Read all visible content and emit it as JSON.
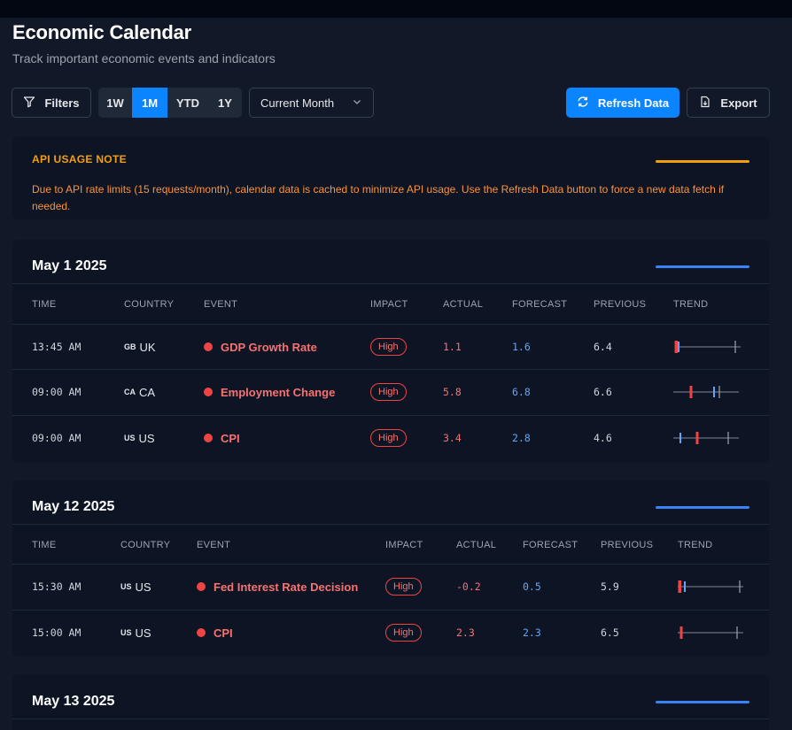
{
  "header": {
    "title": "Economic Calendar",
    "subtitle": "Track important economic events and indicators"
  },
  "toolbar": {
    "filters_label": "Filters",
    "ranges": [
      {
        "label": "1W",
        "active": false
      },
      {
        "label": "1M",
        "active": true
      },
      {
        "label": "YTD",
        "active": false
      },
      {
        "label": "1Y",
        "active": false
      }
    ],
    "period_select": "Current Month",
    "refresh_label": "Refresh Data",
    "export_label": "Export"
  },
  "note": {
    "title": "API USAGE NOTE",
    "text": "Due to API rate limits (15 requests/month), calendar data is cached to minimize API usage. Use the Refresh Data button to force a new data fetch if needed."
  },
  "columns": {
    "time": "TIME",
    "country": "COUNTRY",
    "event": "EVENT",
    "impact": "IMPACT",
    "actual": "ACTUAL",
    "forecast": "FORECAST",
    "previous": "PREVIOUS",
    "trend": "TREND"
  },
  "days": [
    {
      "date": "May 1 2025",
      "events": [
        {
          "time": "13:45 AM",
          "flag": "GB",
          "country": "UK",
          "event": "GDP Growth Rate",
          "impact": "High",
          "actual": "1.1",
          "forecast": "1.6",
          "previous": "6.4"
        },
        {
          "time": "09:00 AM",
          "flag": "CA",
          "country": "CA",
          "event": "Employment Change",
          "impact": "High",
          "actual": "5.8",
          "forecast": "6.8",
          "previous": "6.6"
        },
        {
          "time": "09:00 AM",
          "flag": "US",
          "country": "US",
          "event": "CPI",
          "impact": "High",
          "actual": "3.4",
          "forecast": "2.8",
          "previous": "4.6"
        }
      ]
    },
    {
      "date": "May 12 2025",
      "events": [
        {
          "time": "15:30 AM",
          "flag": "US",
          "country": "US",
          "event": "Fed Interest Rate Decision",
          "impact": "High",
          "actual": "-0.2",
          "forecast": "0.5",
          "previous": "5.9"
        },
        {
          "time": "15:00 AM",
          "flag": "US",
          "country": "US",
          "event": "CPI",
          "impact": "High",
          "actual": "2.3",
          "forecast": "2.3",
          "previous": "6.5"
        }
      ]
    },
    {
      "date": "May 13 2025",
      "events": []
    }
  ],
  "colors": {
    "accent": "#0a84ff",
    "note": "#f59e0b",
    "actual": "#ef4444",
    "forecast": "#60a5fa",
    "previous": "#9ca3af",
    "section_bar": "#3b82f6"
  }
}
